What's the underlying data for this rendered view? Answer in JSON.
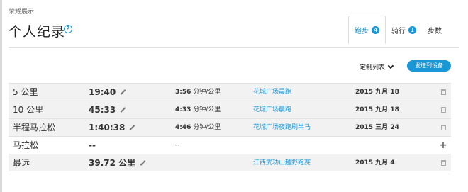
{
  "breadcrumb": "荣耀展示",
  "title": "个人纪录",
  "tabs": [
    {
      "label": "跑步",
      "count": "4"
    },
    {
      "label": "骑行",
      "count": "1"
    },
    {
      "label": "步数"
    }
  ],
  "toolbar": {
    "customize_label": "定制列表",
    "send_label": "发送到设备"
  },
  "records": [
    {
      "distance": "5 公里",
      "time": "19:40",
      "pace_value": "3:56",
      "pace_unit": "分钟/公里",
      "event": "花城广场晨跑",
      "date": "2015 九月 18",
      "action": "delete"
    },
    {
      "distance": "10 公里",
      "time": "45:33",
      "pace_value": "4:33",
      "pace_unit": "分钟/公里",
      "event": "花城广场晨跑",
      "date": "2015 九月 18",
      "action": "delete"
    },
    {
      "distance": "半程马拉松",
      "time": "1:40:38",
      "pace_value": "4:46",
      "pace_unit": "分钟/公里",
      "event": "花城广场夜跑刷半马",
      "date": "2015 三月 24",
      "action": "delete"
    },
    {
      "distance": "马拉松",
      "time": "--",
      "pace_value": "--",
      "pace_unit": "",
      "event": "",
      "date": "",
      "action": "add"
    },
    {
      "distance": "最远",
      "time": "39.72 公里",
      "pace_value": "",
      "pace_unit": "",
      "event": "江西武功山越野跑赛",
      "date": "2015 九月 4",
      "action": "delete"
    }
  ],
  "colors": {
    "accent": "#1a98d5"
  }
}
